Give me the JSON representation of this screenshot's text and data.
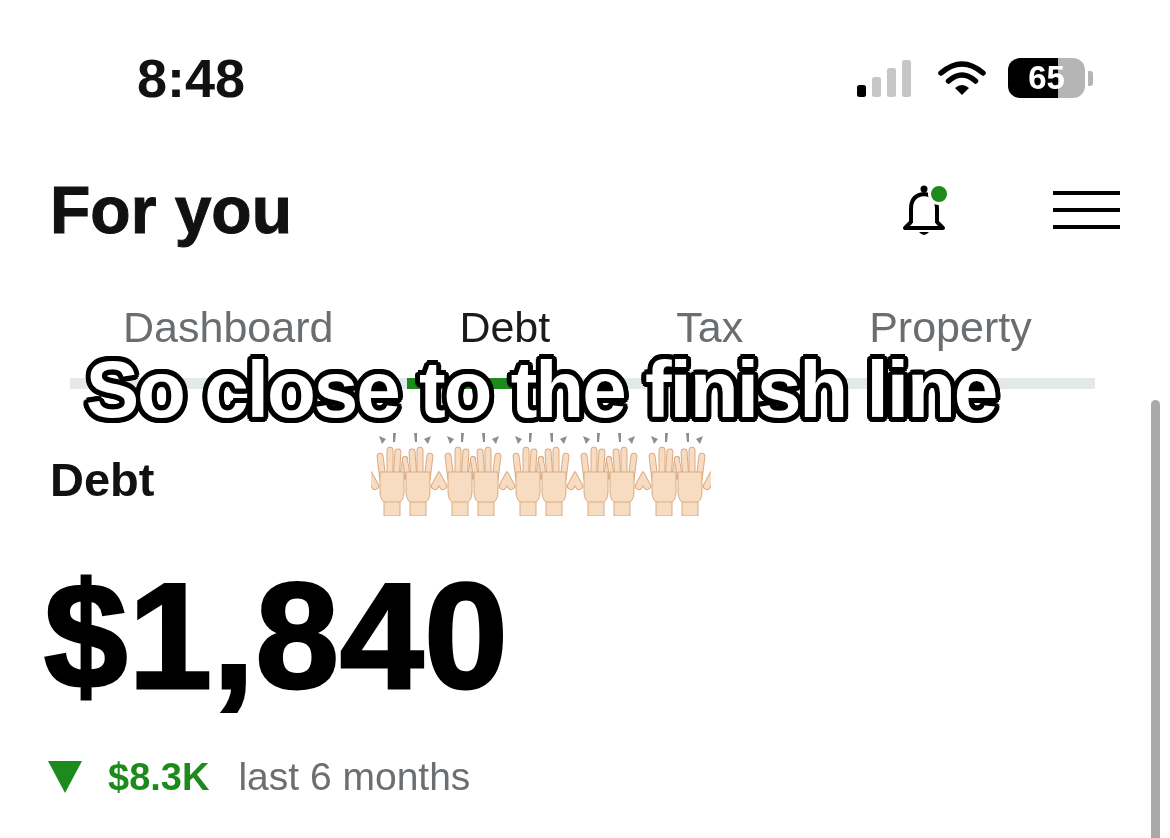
{
  "status_bar": {
    "time": "8:48",
    "battery": "65"
  },
  "header": {
    "title": "For you",
    "notification_unread": true
  },
  "tabs": [
    {
      "label": "Dashboard",
      "selected": false
    },
    {
      "label": "Debt",
      "selected": true
    },
    {
      "label": "Tax",
      "selected": false
    },
    {
      "label": "Property",
      "selected": false
    }
  ],
  "section": {
    "title": "Debt",
    "amount": "$1,840",
    "change": {
      "kind": "down",
      "amount": "$8.3K",
      "period": "last 6 months"
    }
  },
  "caption_overlay": {
    "text": "So close to the finish line",
    "emojis": [
      {
        "kind": "raised-hands"
      },
      {
        "kind": "raised-hands"
      },
      {
        "kind": "raised-hands"
      },
      {
        "kind": "raised-hands"
      },
      {
        "kind": "raised-hands"
      }
    ]
  }
}
